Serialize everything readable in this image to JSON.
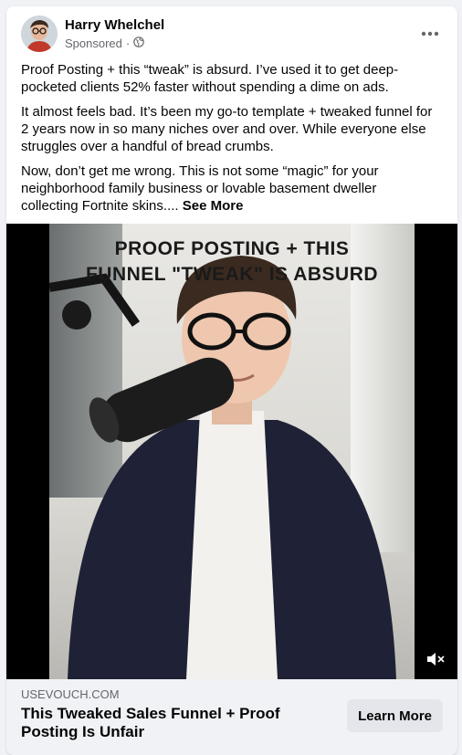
{
  "post": {
    "author": "Harry Whelchel",
    "sponsored_label": "Sponsored",
    "visibility_icon": "globe-icon",
    "more_icon": "ellipsis-icon",
    "paragraphs": [
      "Proof Posting + this “tweak” is absurd. I’ve used it to get deep-pocketed clients 52% faster without spending a dime on ads.",
      "It almost feels bad. It’s been my go-to template + tweaked funnel for 2 years now in so many niches over and over. While everyone else struggles over a handful of bread crumbs.",
      "Now, don’t get me wrong. This is not some “magic” for your neighborhood family business or lovable basement dweller collecting Fortnite skins...."
    ],
    "see_more_label": "See More"
  },
  "video": {
    "overlay_line1": "PROOF POSTING + THIS",
    "overlay_line2": "FUNNEL \"TWEAK\" IS ABSURD",
    "mute_icon": "muted-speaker-icon"
  },
  "link_preview": {
    "domain": "USEVOUCH.COM",
    "headline": "This Tweaked Sales Funnel + Proof Posting Is Unfair",
    "cta_label": "Learn More"
  },
  "colors": {
    "card_bg": "#ffffff",
    "page_bg": "#f0f2f5",
    "secondary_text": "#65676b",
    "button_bg": "#e4e6eb"
  }
}
